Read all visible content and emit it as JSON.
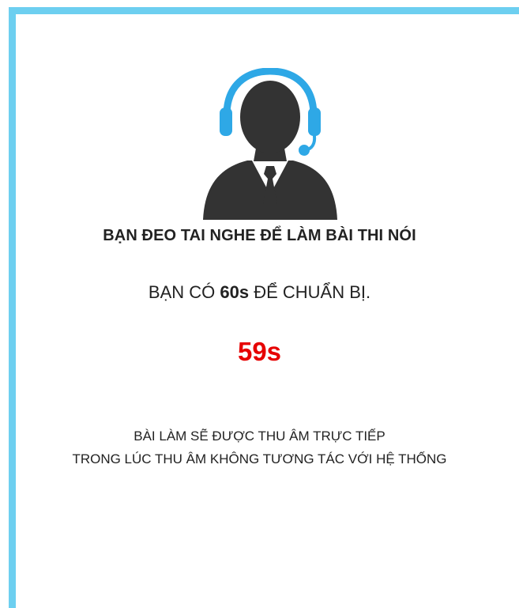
{
  "colors": {
    "frame": "#6dcff0",
    "headset": "#2ea8e6",
    "figure": "#333333",
    "countdown": "#e60000"
  },
  "icon": "headset-agent-icon",
  "title": "BẠN ĐEO TAI NGHE ĐỂ LÀM BÀI THI NÓI",
  "prep": {
    "before": "BẠN CÓ ",
    "seconds": "60s",
    "after": " ĐỂ CHUẨN BỊ."
  },
  "countdown": "59s",
  "notes": [
    "BÀI LÀM SẼ ĐƯỢC THU ÂM TRỰC TIẾP",
    "TRONG LÚC THU ÂM KHÔNG TƯƠNG TÁC VỚI HỆ THỐNG"
  ]
}
